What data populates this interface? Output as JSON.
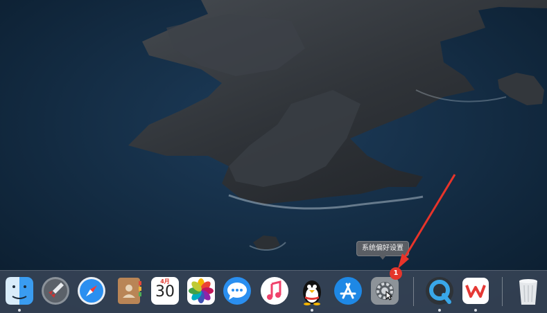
{
  "desktop": {
    "wallpaper": "catalina-island"
  },
  "tooltip": {
    "text": "系统偏好设置"
  },
  "calendar": {
    "month": "4月",
    "day": "30"
  },
  "badge": {
    "count": "1"
  },
  "dock": {
    "apps": [
      {
        "name": "finder",
        "icon": "finder-icon"
      },
      {
        "name": "launchpad",
        "icon": "rocket-icon"
      },
      {
        "name": "safari",
        "icon": "compass-icon"
      },
      {
        "name": "contacts",
        "icon": "contacts-icon"
      },
      {
        "name": "calendar",
        "icon": "calendar-icon"
      },
      {
        "name": "photos",
        "icon": "photos-icon"
      },
      {
        "name": "messages",
        "icon": "speech-bubble-icon"
      },
      {
        "name": "music",
        "icon": "music-note-icon"
      },
      {
        "name": "qq",
        "icon": "penguin-icon"
      },
      {
        "name": "app-store",
        "icon": "app-store-icon"
      },
      {
        "name": "system-preferences",
        "icon": "gear-icon"
      },
      {
        "name": "quicktime",
        "icon": "quicktime-icon"
      },
      {
        "name": "wps-office",
        "icon": "wps-icon"
      },
      {
        "name": "trash",
        "icon": "trash-icon"
      }
    ]
  },
  "colors": {
    "dock": "#3c485a",
    "badge": "#e5362c",
    "arrow": "#e8342a"
  }
}
